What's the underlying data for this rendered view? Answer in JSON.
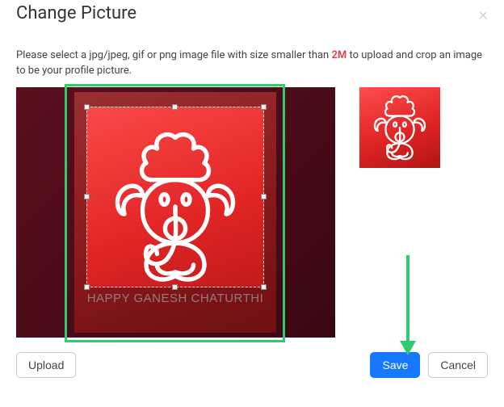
{
  "modal": {
    "title": "Change Picture",
    "close": "×",
    "instruction_pre": "Please select a jpg/jpeg, gif or png image file with size smaller than ",
    "max_size": "2M",
    "instruction_post": " to upload and crop an image to be your profile picture."
  },
  "image": {
    "caption": "happy ganesh chaturthi"
  },
  "buttons": {
    "upload": "Upload",
    "save": "Save",
    "cancel": "Cancel"
  }
}
